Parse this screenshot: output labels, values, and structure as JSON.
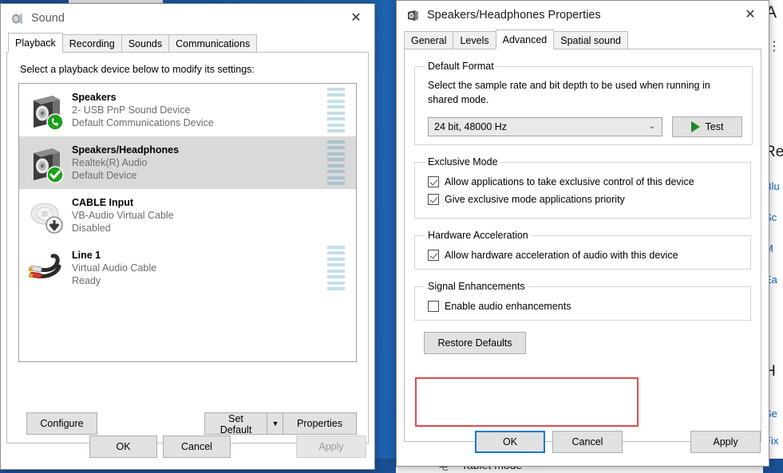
{
  "desktop": {
    "tablet_mode_label": "Tablet mode",
    "tablet_icon": "tablet-mode-icon",
    "settings_fragments": {
      "heading_a": "A",
      "menu_dots": "⋮",
      "heading_re": "Re",
      "link_blu": "Blu",
      "link_sc": "Sc",
      "link_m": "M",
      "link_ea": "Ea",
      "heading_h": "H",
      "link_se": "Se",
      "link_fix": "Fix"
    }
  },
  "sound_window": {
    "title": "Sound",
    "title_icon": "speaker-icon",
    "close_label": "✕",
    "tabs": [
      {
        "label": "Playback",
        "active": true
      },
      {
        "label": "Recording",
        "active": false
      },
      {
        "label": "Sounds",
        "active": false
      },
      {
        "label": "Communications",
        "active": false
      }
    ],
    "hint": "Select a playback device below to modify its settings:",
    "devices": [
      {
        "name": "Speakers",
        "driver": "2- USB PnP Sound Device",
        "status": "Default Communications Device",
        "icon": "speaker-box-icon",
        "badge": "green-phone-badge",
        "selected": false,
        "meter_visible": true,
        "meter_level": 8
      },
      {
        "name": "Speakers/Headphones",
        "driver": "Realtek(R) Audio",
        "status": "Default Device",
        "icon": "speaker-box-icon",
        "badge": "green-check-badge",
        "selected": true,
        "meter_visible": true,
        "meter_level": 8
      },
      {
        "name": "CABLE Input",
        "driver": "VB-Audio Virtual Cable",
        "status": "Disabled",
        "icon": "microphone-jack-icon",
        "badge": "down-arrow-badge",
        "selected": false,
        "meter_visible": false,
        "meter_level": 0
      },
      {
        "name": "Line 1",
        "driver": "Virtual Audio Cable",
        "status": "Ready",
        "icon": "rca-cable-icon",
        "badge": "none",
        "selected": false,
        "meter_visible": true,
        "meter_level": 8
      }
    ],
    "buttons": {
      "configure": "Configure",
      "set_default": "Set Default",
      "set_default_arrow": "▼",
      "properties": "Properties",
      "ok": "OK",
      "cancel": "Cancel",
      "apply": "Apply",
      "apply_disabled": true
    }
  },
  "properties_window": {
    "title": "Speakers/Headphones Properties",
    "title_icon": "speaker-small-icon",
    "close_label": "✕",
    "tabs": [
      {
        "label": "General",
        "active": false
      },
      {
        "label": "Levels",
        "active": false
      },
      {
        "label": "Advanced",
        "active": true
      },
      {
        "label": "Spatial sound",
        "active": false
      }
    ],
    "default_format": {
      "legend": "Default Format",
      "description": "Select the sample rate and bit depth to be used when running in shared mode.",
      "selected_value": "24 bit, 48000 Hz",
      "chevron": "⌄",
      "test_button": "Test",
      "test_icon": "play-triangle-icon"
    },
    "exclusive_mode": {
      "legend": "Exclusive Mode",
      "checkboxes": [
        {
          "label": "Allow applications to take exclusive control of this device",
          "checked": true
        },
        {
          "label": "Give exclusive mode applications priority",
          "checked": true
        }
      ]
    },
    "hardware_acceleration": {
      "legend": "Hardware Acceleration",
      "checkboxes": [
        {
          "label": "Allow hardware acceleration of audio with this device",
          "checked": true
        }
      ]
    },
    "signal_enhancements": {
      "legend": "Signal Enhancements",
      "checkboxes": [
        {
          "label": "Enable audio enhancements",
          "checked": false
        }
      ],
      "highlight_color": "#e04b4b"
    },
    "restore_defaults": "Restore Defaults",
    "buttons": {
      "ok": "OK",
      "cancel": "Cancel",
      "apply": "Apply",
      "ok_is_default": true
    }
  }
}
